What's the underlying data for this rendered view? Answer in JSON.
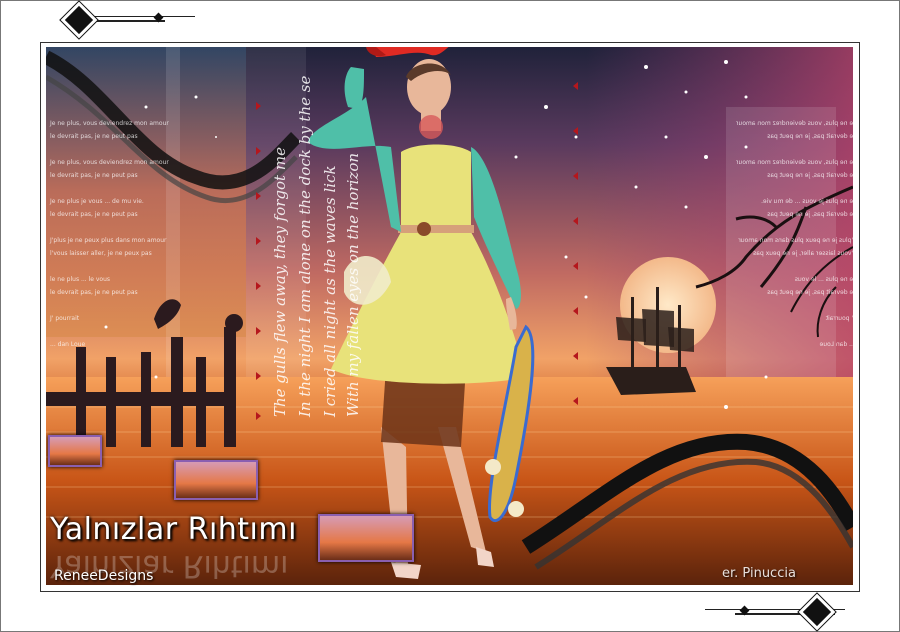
{
  "artwork": {
    "title": "Yalnızlar Rıhtımı",
    "signature_designer": "ReneeDesigns",
    "signature_tube": "er. Pinuccia",
    "poem_lines": [
      "The gulls flew away, they forgot me",
      "In the night I am alone on the dock by the se",
      "I cried all night as the waves lick",
      "With my fallen eyes on the horizon"
    ],
    "panel_text": "Je ne plus, vous deviendrez mon amour\nle devrait pas, je ne peut pas\n\nJe ne plus, vous deviendrez mon amour\nle devrait pas, je ne peut pas\n\nJe ne plus je vous ... de mu vie.\nle devrait pas, je ne peut pas\n\nJ'plus je ne peux plus dans mon amour\nl'vous laisser aller, je ne peux pas\n\nle ne plus ... le vous\nle devrait pas, je ne peut pas\n\nJ' pourrait\n\n... dan Loue"
  },
  "colors": {
    "sky_top": "#20223a",
    "sunset": "#f1a267",
    "sea": "#c9571d",
    "dress": "#e8e27a",
    "cardigan": "#4fbfa8",
    "hat": "#e02a23"
  }
}
